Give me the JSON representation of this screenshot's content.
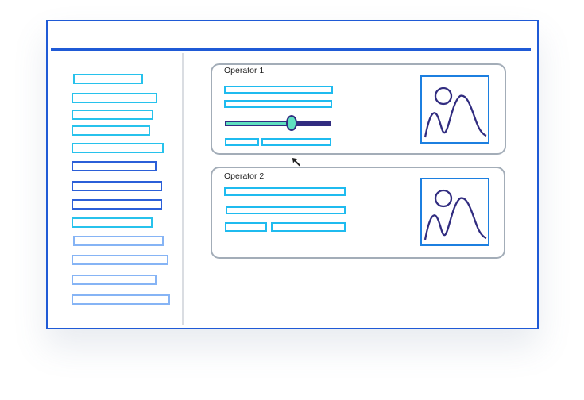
{
  "operators": [
    {
      "title": "Operator 1",
      "slider_value": 0.63
    },
    {
      "title": "Operator 2"
    }
  ],
  "icons": {
    "image_placeholder": "image-placeholder-icon",
    "cursor": "mouse-pointer-icon"
  },
  "colors": {
    "window_border": "#1f5ad6",
    "panel_border": "#a3adb8",
    "field_border": "#1fbbef",
    "slider_track": "#312c80",
    "slider_fill": "#5fe0c0",
    "sidebar_palette": [
      "#27c2ec",
      "#2b5fd8",
      "#86b4f5"
    ]
  }
}
